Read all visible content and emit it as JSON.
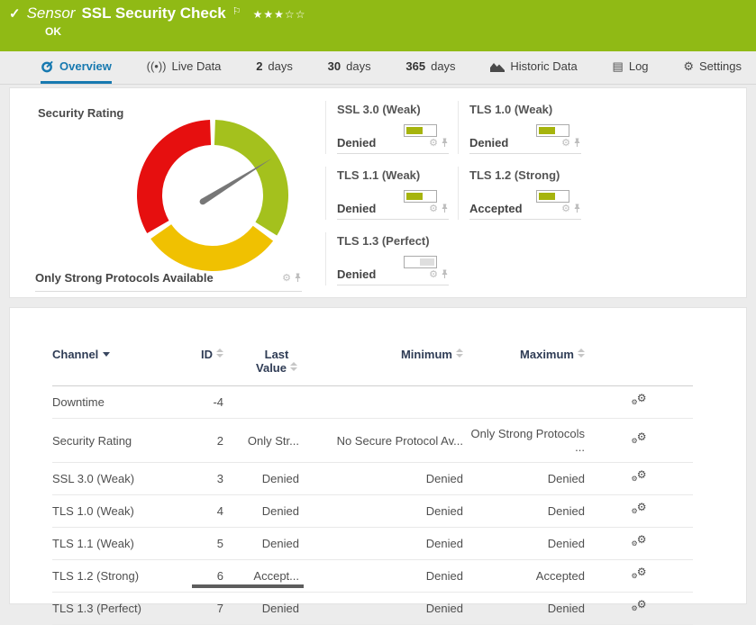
{
  "header": {
    "check_icon": "✓",
    "kind": "Sensor",
    "title": "SSL Security Check",
    "flag_icon": "⚐",
    "stars": "★★★☆☆",
    "status": "OK",
    "bg_color": "#90ba15"
  },
  "tabs": [
    {
      "label": "Overview",
      "active": true
    },
    {
      "label": "Live Data"
    },
    {
      "num": "2",
      "label": "days"
    },
    {
      "num": "30",
      "label": "days"
    },
    {
      "num": "365",
      "label": "days"
    },
    {
      "label": "Historic Data"
    },
    {
      "label": "Log"
    },
    {
      "label": "Settings"
    }
  ],
  "icons": {
    "live_data": "((•))",
    "log": "▤",
    "gear": "⚙",
    "edit_gear": "⚙"
  },
  "overview": {
    "gauge": {
      "title": "Security Rating",
      "value": "Only Strong Protocols Available"
    },
    "tiles": [
      {
        "title": "SSL 3.0 (Weak)",
        "value": "Denied",
        "bar": {
          "color": "#a6b40d",
          "side": "left",
          "pct": 50
        }
      },
      {
        "title": "TLS 1.0 (Weak)",
        "value": "Denied",
        "bar": {
          "color": "#a6b40d",
          "side": "left",
          "pct": 50
        }
      },
      {
        "title": "TLS 1.1 (Weak)",
        "value": "Denied",
        "bar": {
          "color": "#a6b40d",
          "side": "left",
          "pct": 50
        }
      },
      {
        "title": "TLS 1.2 (Strong)",
        "value": "Accepted",
        "bar": {
          "color": "#a6b40d",
          "side": "left",
          "pct": 50
        }
      },
      {
        "title": "TLS 1.3 (Perfect)",
        "value": "Denied",
        "bar": {
          "color": "#dedede",
          "side": "right",
          "pct": 45
        }
      }
    ]
  },
  "table": {
    "headers": {
      "channel": "Channel",
      "id": "ID",
      "last": "Last Value",
      "min": "Minimum",
      "max": "Maximum"
    },
    "rows": [
      {
        "channel": "Downtime",
        "id": "-4",
        "last": "",
        "min": "",
        "max": ""
      },
      {
        "channel": "Security Rating",
        "id": "2",
        "last": "Only Str...",
        "min": "No Secure Protocol Av...",
        "max": "Only Strong Protocols ..."
      },
      {
        "channel": "SSL 3.0 (Weak)",
        "id": "3",
        "last": "Denied",
        "min": "Denied",
        "max": "Denied"
      },
      {
        "channel": "TLS 1.0 (Weak)",
        "id": "4",
        "last": "Denied",
        "min": "Denied",
        "max": "Denied"
      },
      {
        "channel": "TLS 1.1 (Weak)",
        "id": "5",
        "last": "Denied",
        "min": "Denied",
        "max": "Denied"
      },
      {
        "channel": "TLS 1.2 (Strong)",
        "id": "6",
        "last": "Accept...",
        "min": "Denied",
        "max": "Accepted"
      },
      {
        "channel": "TLS 1.3 (Perfect)",
        "id": "7",
        "last": "Denied",
        "min": "Denied",
        "max": "Denied"
      }
    ]
  },
  "chart_data": {
    "type": "gauge",
    "title": "Security Rating",
    "value_label": "Only Strong Protocols Available",
    "needle_angle_deg": 58,
    "needle_color": "#777777",
    "segments": [
      {
        "name": "strong",
        "color": "#a4c11d",
        "start_deg": 2,
        "end_deg": 122
      },
      {
        "name": "weak",
        "color": "#f0c101",
        "start_deg": 127,
        "end_deg": 235
      },
      {
        "name": "insecure",
        "color": "#e60f0f",
        "start_deg": 240,
        "end_deg": 358
      }
    ]
  }
}
